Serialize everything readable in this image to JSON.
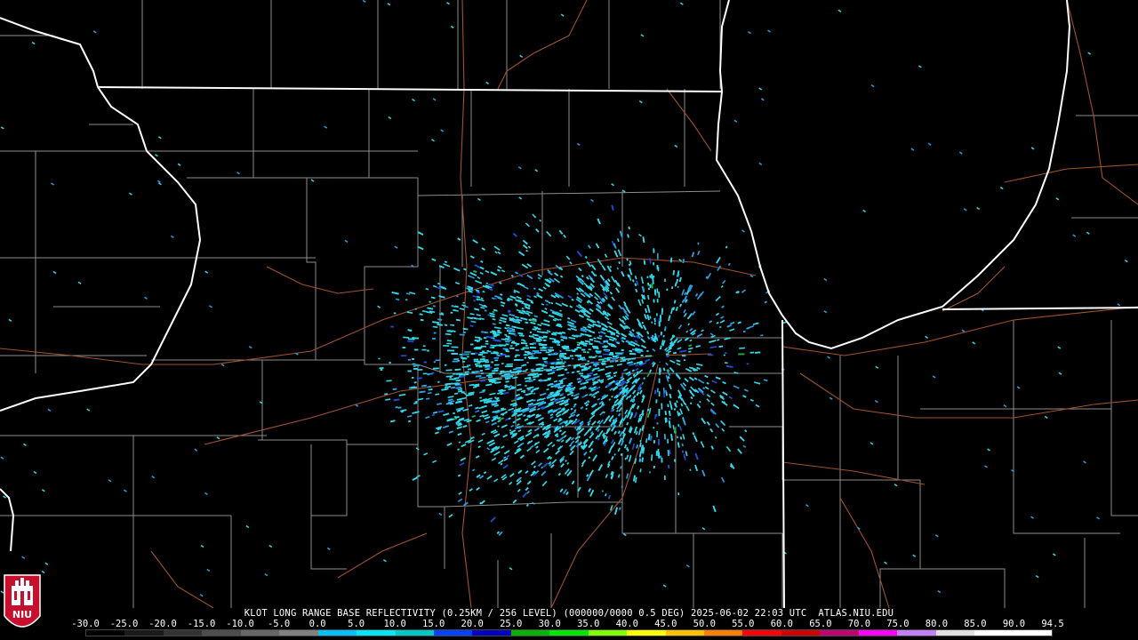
{
  "product": {
    "caption": "KLOT LONG RANGE BASE REFLECTIVITY (0.25KM / 256 LEVEL) (000000/0000 0.5 DEG) 2025-06-02 22:03 UTC  ATLAS.NIU.EDU"
  },
  "legend": {
    "ticks": [
      "-30.0",
      "-25.0",
      "-20.0",
      "-15.0",
      "-10.0",
      "-5.0",
      "0.0",
      "5.0",
      "10.0",
      "15.0",
      "20.0",
      "25.0",
      "30.0",
      "35.0",
      "40.0",
      "45.0",
      "50.0",
      "55.0",
      "60.0",
      "65.0",
      "70.0",
      "75.0",
      "80.0",
      "85.0",
      "90.0",
      "94.5"
    ],
    "colors": [
      "#000000",
      "#1a1a1a",
      "#333333",
      "#4d4d4d",
      "#666666",
      "#808080",
      "#00c0ff",
      "#00e6ff",
      "#00c8c8",
      "#0040ff",
      "#0000c0",
      "#00b400",
      "#00e600",
      "#80ff00",
      "#ffff00",
      "#ffc000",
      "#ff8000",
      "#ff0000",
      "#d00000",
      "#c00070",
      "#ff00ff",
      "#c080ff",
      "#e0e0e0",
      "#ffffff",
      "#ffffff"
    ]
  },
  "logo": {
    "text": "NIU"
  },
  "colors": {
    "state_border": "#ffffff",
    "county_border": "#8c8c8c",
    "road": "#a0522d",
    "echo_light": "#30d8e8",
    "echo_mid": "#2a9fe0",
    "echo_dark": "#2050d0",
    "echo_green": "#20b040"
  }
}
